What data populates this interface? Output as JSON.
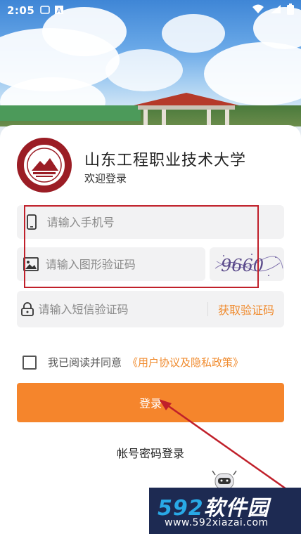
{
  "status_bar": {
    "time": "2:05",
    "left_icons": [
      "notification-icon",
      "a-letter-icon"
    ],
    "right_icons": [
      "wifi-icon",
      "signal-icon",
      "battery-icon"
    ]
  },
  "header": {
    "school_name": "山东工程职业技术大学",
    "subtitle": "欢迎登录"
  },
  "form": {
    "phone_placeholder": "请输入手机号",
    "image_code_placeholder": "请输入图形验证码",
    "captcha_text": "9660",
    "sms_placeholder": "请输入短信验证码",
    "get_code_label": "获取验证码"
  },
  "agreement": {
    "text": "我已阅读并同意",
    "policy_link": "《用户协议及隐私政策》",
    "checked": false
  },
  "login_button": "登录",
  "alt_login": "帐号密码登录",
  "watermark": {
    "logo_number": "592",
    "logo_text": "软件园",
    "url": "www.592xiazai.com"
  },
  "colors": {
    "accent": "#f5852c",
    "link": "#f08a2c",
    "field_bg": "#f2f2f3",
    "annotation": "#c0202a"
  }
}
